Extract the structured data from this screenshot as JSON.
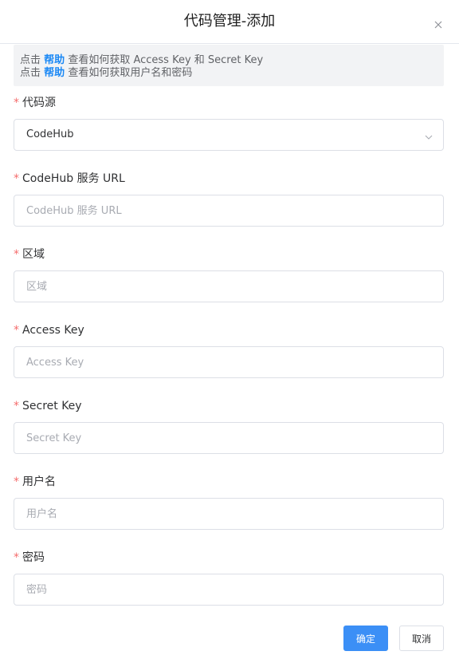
{
  "dialog": {
    "title": "代码管理-添加"
  },
  "tip": {
    "line1_prefix": "点击",
    "line1_link": "帮助",
    "line1_suffix": "查看如何获取 Access Key 和 Secret Key",
    "line2_prefix": "点击",
    "line2_link": "帮助",
    "line2_suffix": "查看如何获取用户名和密码"
  },
  "form": {
    "required_mark": "*",
    "source": {
      "label": "代码源",
      "value": "CodeHub"
    },
    "url": {
      "label": "CodeHub 服务 URL",
      "placeholder": "CodeHub 服务 URL"
    },
    "region": {
      "label": "区域",
      "placeholder": "区域"
    },
    "access_key": {
      "label": "Access Key",
      "placeholder": "Access Key"
    },
    "secret_key": {
      "label": "Secret Key",
      "placeholder": "Secret Key"
    },
    "username": {
      "label": "用户名",
      "placeholder": "用户名"
    },
    "password": {
      "label": "密码",
      "placeholder": "密码"
    }
  },
  "footer": {
    "confirm_label": "确定",
    "cancel_label": "取消"
  },
  "icons": {
    "close": "close-icon",
    "select_arrow": "chevron-down-icon"
  },
  "colors": {
    "primary": "#3b8ff6",
    "link": "#1a88f5",
    "required": "#f56c6c",
    "tip_background": "#f2f3f5"
  }
}
